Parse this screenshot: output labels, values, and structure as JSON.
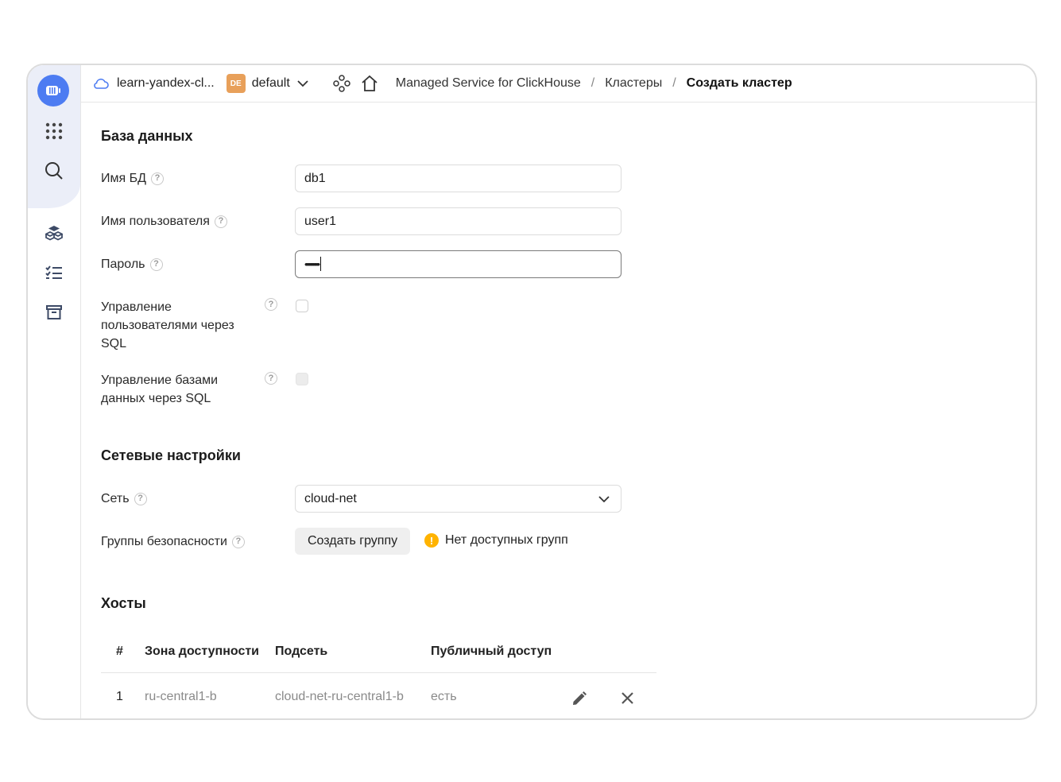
{
  "header": {
    "cloud_name": "learn-yandex-cl...",
    "folder_badge": "DE",
    "folder_name": "default",
    "breadcrumbs": [
      "Managed Service for ClickHouse",
      "Кластеры",
      "Создать кластер"
    ],
    "separator": "/"
  },
  "sidebar": {
    "icons": [
      "clickhouse-logo-icon",
      "apps-grid-icon",
      "search-icon",
      "clusters-icon",
      "operations-list-icon",
      "archive-icon"
    ]
  },
  "database": {
    "title": "База данных",
    "db_name": {
      "label": "Имя БД",
      "value": "db1"
    },
    "user_name": {
      "label": "Имя пользователя",
      "value": "user1"
    },
    "password": {
      "label": "Пароль",
      "value": "•••••••••••"
    },
    "sql_user_mgmt": {
      "label": "Управление пользователями через SQL",
      "checked": false
    },
    "sql_db_mgmt": {
      "label": "Управление базами данных через SQL",
      "checked": false,
      "disabled": true
    },
    "help_glyph": "?"
  },
  "network": {
    "title": "Сетевые настройки",
    "net": {
      "label": "Сеть",
      "value": "cloud-net"
    },
    "security_groups": {
      "label": "Группы безопасности",
      "button": "Создать группу",
      "warning": "Нет доступных групп",
      "warning_glyph": "!"
    }
  },
  "hosts": {
    "title": "Хосты",
    "columns": [
      "#",
      "Зона доступности",
      "Подсеть",
      "Публичный доступ"
    ],
    "rows": [
      {
        "num": "1",
        "zone": "ru-central1-b",
        "subnet": "cloud-net-ru-central1-b",
        "public": "есть"
      }
    ]
  },
  "colors": {
    "accent": "#4d7cf2",
    "warning": "#ffb300",
    "badge": "#e8a05a"
  }
}
